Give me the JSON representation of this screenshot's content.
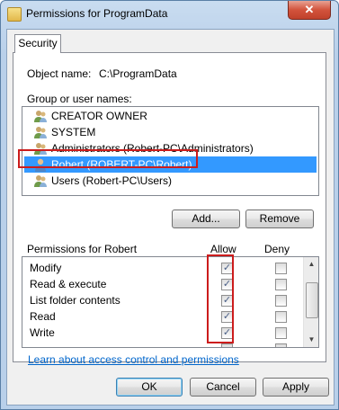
{
  "window": {
    "title": "Permissions for ProgramData",
    "close_symbol": "✕"
  },
  "tabs": [
    {
      "label": "Security"
    }
  ],
  "object": {
    "label": "Object name:",
    "value": "C:\\ProgramData"
  },
  "group_list": {
    "label": "Group or user names:",
    "items": [
      {
        "name": "CREATOR OWNER",
        "icon": "group-icon"
      },
      {
        "name": "SYSTEM",
        "icon": "group-icon"
      },
      {
        "name": "Administrators (Robert-PC\\Administrators)",
        "icon": "group-icon"
      },
      {
        "name": "Robert (ROBERT-PC\\Robert)",
        "icon": "user-icon",
        "selected": true
      },
      {
        "name": "Users (Robert-PC\\Users)",
        "icon": "group-icon"
      }
    ]
  },
  "buttons": {
    "add": "Add...",
    "remove": "Remove",
    "ok": "OK",
    "cancel": "Cancel",
    "apply": "Apply"
  },
  "permissions": {
    "header": "Permissions for Robert",
    "allow_header": "Allow",
    "deny_header": "Deny",
    "rows": [
      {
        "name": "Modify",
        "allow": true,
        "deny": false
      },
      {
        "name": "Read & execute",
        "allow": true,
        "deny": false
      },
      {
        "name": "List folder contents",
        "allow": true,
        "deny": false
      },
      {
        "name": "Read",
        "allow": true,
        "deny": false
      },
      {
        "name": "Write",
        "allow": true,
        "deny": false
      }
    ],
    "check_mark": "✓",
    "scroll_up": "▲",
    "scroll_down": "▼"
  },
  "link": "Learn about access control and permissions",
  "colors": {
    "selection": "#3399ff",
    "highlight_box": "#cc1c1c",
    "link": "#0066cc"
  }
}
